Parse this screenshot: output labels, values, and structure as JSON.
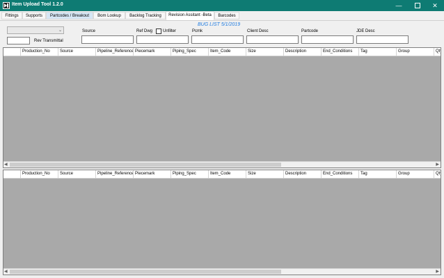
{
  "window": {
    "title": "Item Upload Tool 1.2.0"
  },
  "tabs": [
    {
      "label": "Fittings"
    },
    {
      "label": "Supports"
    },
    {
      "label": "Partcodes / Breakout"
    },
    {
      "label": "Bom Lookup"
    },
    {
      "label": "Backlog Tracking"
    },
    {
      "label": "Revision Assitant -Beta"
    },
    {
      "label": "Barcodes"
    }
  ],
  "form": {
    "bug_list": "BUG LIST 5/1/2019",
    "rev_label": "Rev Transmittal",
    "unfilter_label": "Unfilter",
    "fields": [
      {
        "label": "Source",
        "value": ""
      },
      {
        "label": "Ref Dwg",
        "value": ""
      },
      {
        "label": "Pcmk",
        "value": ""
      },
      {
        "label": "Client Desc",
        "value": ""
      },
      {
        "label": "Partcode",
        "value": ""
      },
      {
        "label": "JDE Desc",
        "value": ""
      }
    ]
  },
  "grid_columns": [
    "Production_No",
    "Source",
    "Pipeline_Reference",
    "Piecemark",
    "Piping_Spec",
    "Item_Code",
    "Size",
    "Description",
    "End_Conditions",
    "Tag",
    "Group",
    "Qty"
  ]
}
